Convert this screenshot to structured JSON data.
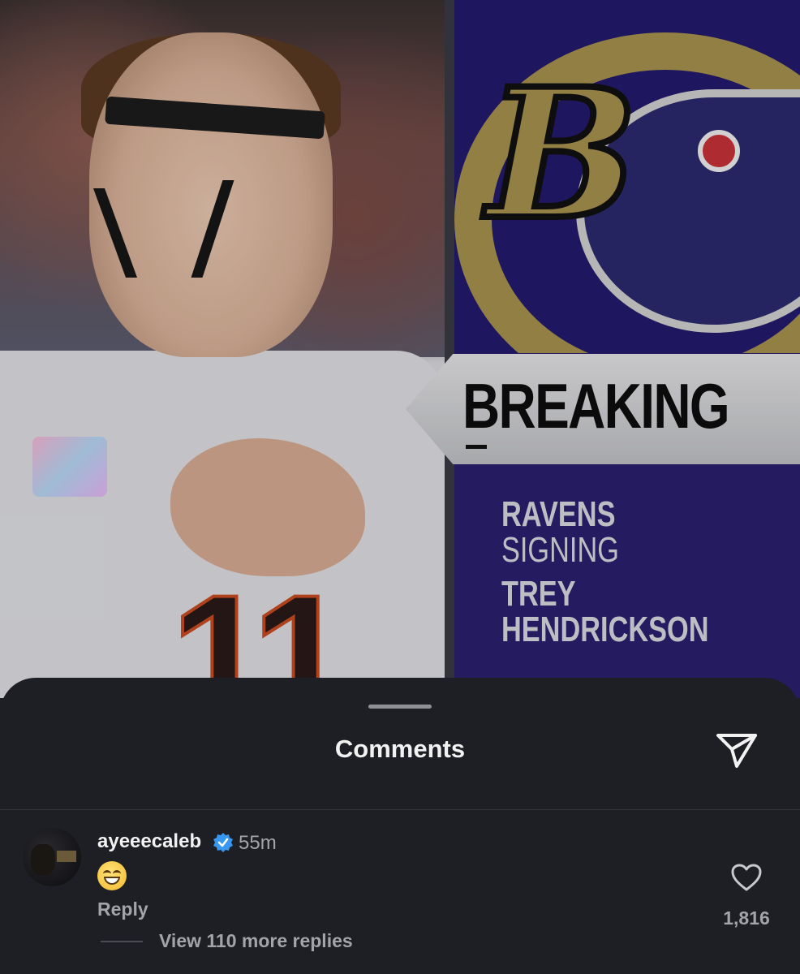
{
  "post": {
    "banner_text": "BREAKING",
    "headline_line1": "RAVENS",
    "headline_line2": "SIGNING",
    "headline_line3": "TREY",
    "headline_line4": "HENDRICKSON"
  },
  "sheet": {
    "title": "Comments",
    "share_icon": "send-icon"
  },
  "comment": {
    "username": "ayeeecaleb",
    "verified": true,
    "time": "55m",
    "body_emoji": "grinning-face-emoji",
    "reply_label": "Reply",
    "like_count": "1,816",
    "view_replies_label": "View 110 more replies"
  },
  "colors": {
    "sheet_bg": "#1e1f24",
    "verified_blue": "#3897f0",
    "muted_text": "#a3a4aa"
  }
}
